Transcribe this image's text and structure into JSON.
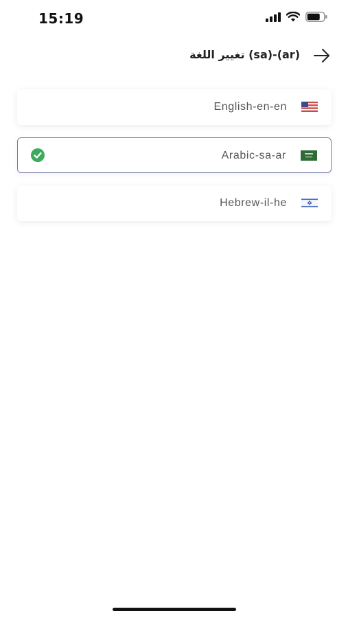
{
  "status_bar": {
    "time": "15:19",
    "icons": [
      "cellular-signal-icon",
      "wifi-icon",
      "battery-icon"
    ]
  },
  "header": {
    "title": "تغيير اللغة (sa)-(ar)",
    "back_icon": "arrow-right-icon"
  },
  "languages": [
    {
      "label": "English-en-en",
      "flag": "us-flag-icon",
      "selected": false
    },
    {
      "label": "Arabic-sa-ar",
      "flag": "saudi-flag-icon",
      "selected": true
    },
    {
      "label": "Hebrew-il-he",
      "flag": "israel-flag-icon",
      "selected": false
    }
  ],
  "colors": {
    "selected_border": "#7b7fa8",
    "check_green": "#3cab5c",
    "text": "#555555"
  }
}
